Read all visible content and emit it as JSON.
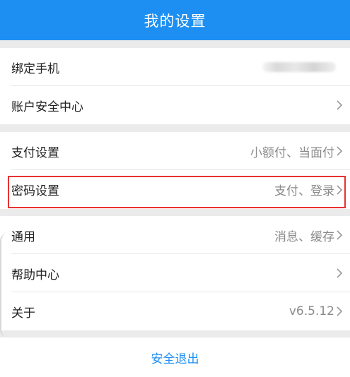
{
  "header": {
    "title": "我的设置"
  },
  "groups": {
    "account": {
      "bind_phone": "绑定手机",
      "security_center": "账户安全中心"
    },
    "payment": {
      "pay_settings": "支付设置",
      "pay_settings_value": "小额付、当面付",
      "password_settings": "密码设置",
      "password_settings_value": "支付、登录"
    },
    "general": {
      "general": "通用",
      "general_value": "消息、缓存",
      "help_center": "帮助中心",
      "about": "关于",
      "about_value": "v6.5.12"
    }
  },
  "logout": {
    "label": "安全退出"
  },
  "colors": {
    "header_bg": "#1e8ff2",
    "page_bg": "#ebebeb",
    "highlight_border": "#e8322f",
    "link_blue": "#1e8ff2"
  },
  "icons": {
    "chevron": "chevron-right-icon"
  }
}
